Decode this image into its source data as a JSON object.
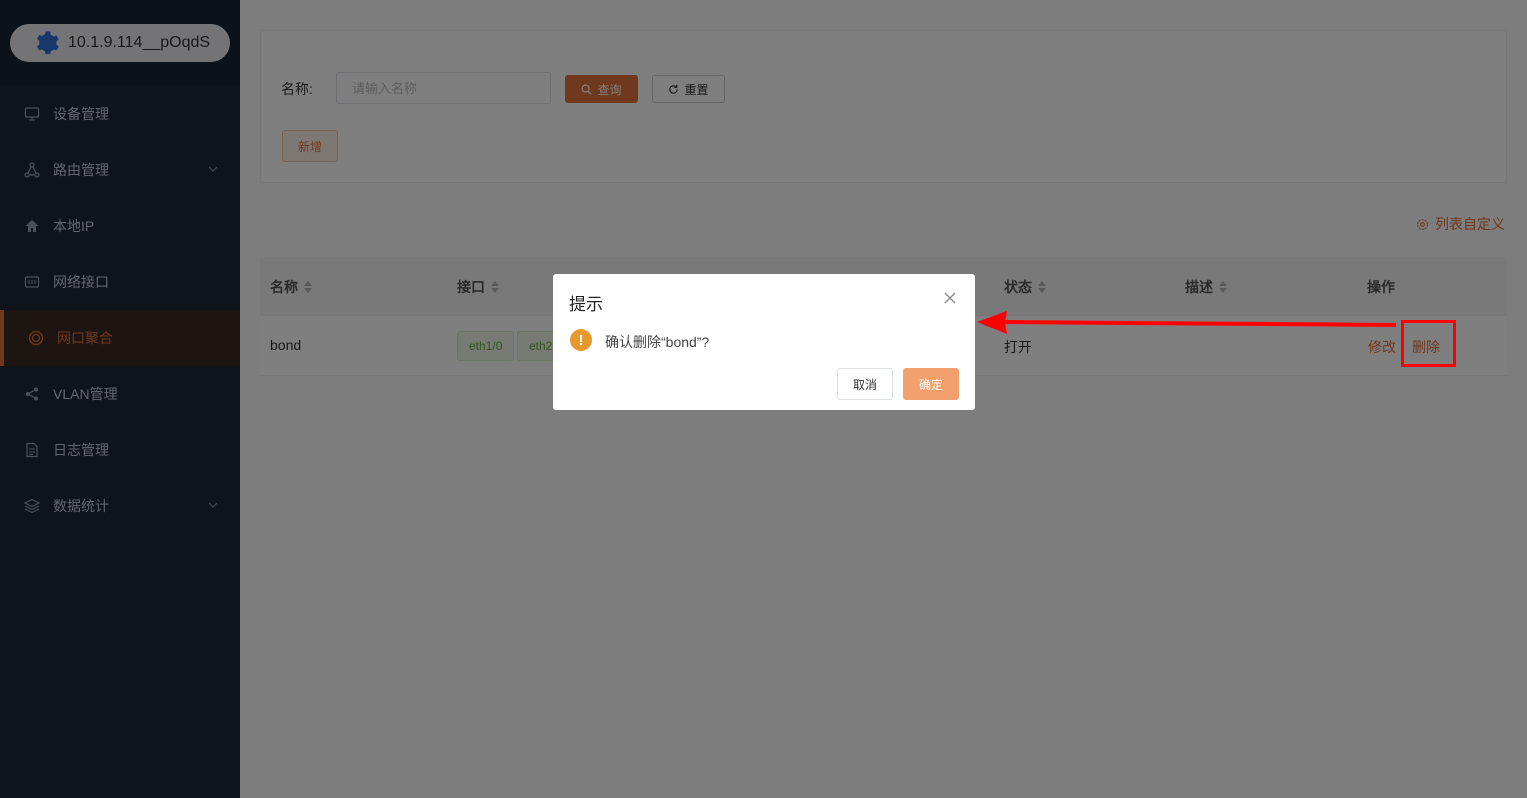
{
  "device": {
    "label": "10.1.9.114__pOqdS",
    "faint_header": "··· · ···· ···· · ·"
  },
  "sidebar": {
    "items": [
      {
        "label": "设备管理",
        "icon": "monitor-icon"
      },
      {
        "label": "路由管理",
        "icon": "network-icon",
        "expandable": true
      },
      {
        "label": "本地IP",
        "icon": "home-icon"
      },
      {
        "label": "网络接口",
        "icon": "interface-icon"
      },
      {
        "label": "网口聚合",
        "icon": "aggregate-icon",
        "active": true
      },
      {
        "label": "VLAN管理",
        "icon": "share-icon"
      },
      {
        "label": "日志管理",
        "icon": "document-icon"
      },
      {
        "label": "数据统计",
        "icon": "layers-icon",
        "expandable": true
      }
    ]
  },
  "search": {
    "name_label": "名称:",
    "name_placeholder": "请输入名称",
    "name_value": "",
    "query_label": "查询",
    "reset_label": "重置",
    "add_label": "新增"
  },
  "toolbar": {
    "custom_list_label": "列表自定义"
  },
  "table": {
    "columns": [
      "名称",
      "接口",
      "状态",
      "描述",
      "操作"
    ],
    "rows": [
      {
        "name": "bond",
        "interfaces": [
          "eth1/0",
          "eth2"
        ],
        "status": "打开",
        "description": "",
        "edit_label": "修改",
        "delete_label": "删除"
      }
    ]
  },
  "dialog": {
    "title": "提示",
    "warning_symbol": "!",
    "message": "确认删除“bond”?",
    "cancel_label": "取消",
    "ok_label": "确定"
  },
  "colors": {
    "accent": "#e0703a",
    "sidebar_bg": "#1f2937",
    "annotation": "#ff0000",
    "warning": "#e69a2e"
  }
}
